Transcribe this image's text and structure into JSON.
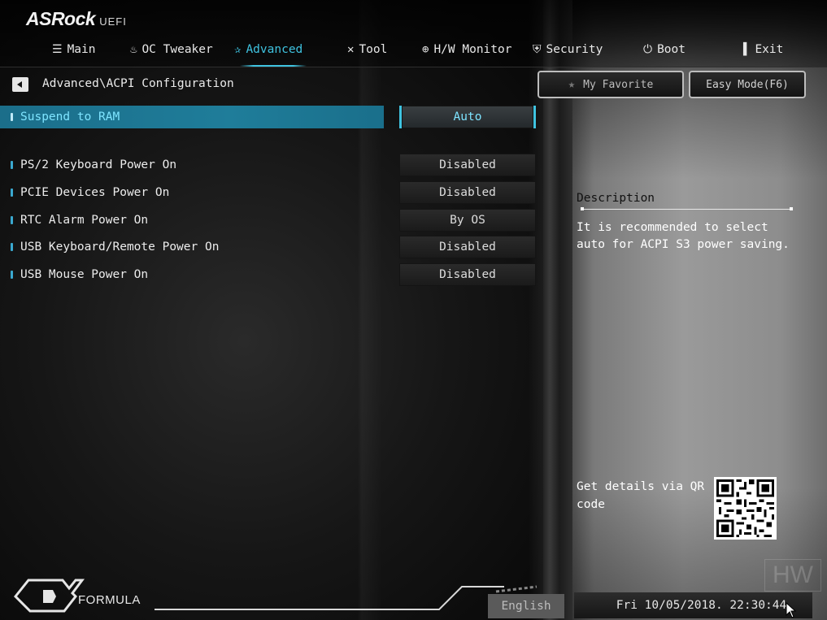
{
  "brand": {
    "name": "ASRock",
    "sub": "UEFI"
  },
  "nav": {
    "tabs": [
      {
        "label": "Main",
        "icon": "list-icon"
      },
      {
        "label": "OC Tweaker",
        "icon": "flame-icon"
      },
      {
        "label": "Advanced",
        "icon": "star-icon"
      },
      {
        "label": "Tool",
        "icon": "tools-icon"
      },
      {
        "label": "H/W Monitor",
        "icon": "target-icon"
      },
      {
        "label": "Security",
        "icon": "shield-icon"
      },
      {
        "label": "Boot",
        "icon": "power-icon"
      },
      {
        "label": "Exit",
        "icon": "door-icon"
      }
    ],
    "active": "Advanced"
  },
  "breadcrumb": "Advanced\\ACPI Configuration",
  "buttons": {
    "favorite": "My Favorite",
    "easy_mode": "Easy Mode(F6)"
  },
  "settings": [
    {
      "label": "Suspend to RAM",
      "value": "Auto",
      "selected": true
    },
    {
      "label": "PS/2 Keyboard Power On",
      "value": "Disabled"
    },
    {
      "label": "PCIE Devices Power On",
      "value": "Disabled"
    },
    {
      "label": "RTC Alarm Power On",
      "value": "By OS"
    },
    {
      "label": "USB Keyboard/Remote Power On",
      "value": "Disabled"
    },
    {
      "label": "USB Mouse Power On",
      "value": "Disabled"
    }
  ],
  "description": {
    "title": "Description",
    "text": "It is recommended to select auto for ACPI S3 power saving."
  },
  "qr": {
    "label": "Get details via QR code"
  },
  "footer": {
    "formula": "FORMULA",
    "language": "English",
    "datetime": "Fri 10/05/2018. 22:30:44"
  },
  "watermark": "HW",
  "colors": {
    "accent": "#3fc3e0",
    "selected_row": "#1f7d9a"
  }
}
